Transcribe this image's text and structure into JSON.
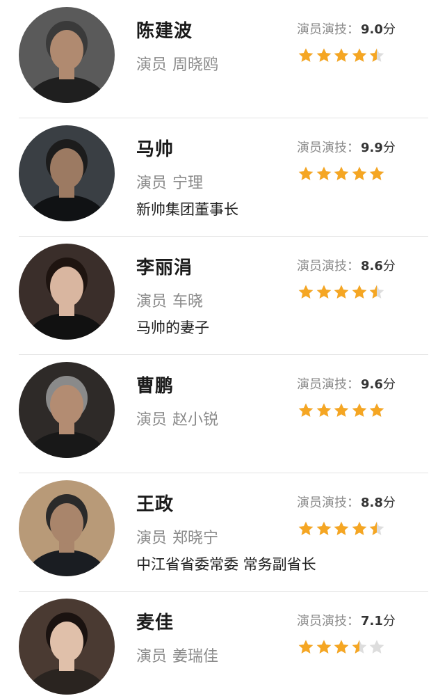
{
  "rating_label": "演员演技：",
  "rating_unit": "分",
  "role_label": "演员",
  "colors": {
    "star_filled": "#f5a623",
    "star_empty": "#dddddd",
    "divider": "#e3e3e3"
  },
  "cast": [
    {
      "character": "陈建波",
      "actor": "周晓鸥",
      "description": "",
      "score": "9.0",
      "stars": 4.5,
      "avatar": {
        "bg": "#5a5a5a",
        "skin": "#b08a70",
        "hair": "#3a3a3a",
        "clothes": "#1f1f1f"
      }
    },
    {
      "character": "马帅",
      "actor": "宁理",
      "description": "新帅集团董事长",
      "score": "9.9",
      "stars": 5,
      "avatar": {
        "bg": "#3a3f44",
        "skin": "#9c7a62",
        "hair": "#1c1c1c",
        "clothes": "#101214"
      }
    },
    {
      "character": "李丽涓",
      "actor": "车晓",
      "description": "马帅的妻子",
      "score": "8.6",
      "stars": 4.5,
      "avatar": {
        "bg": "#3a2e2a",
        "skin": "#d9b6a0",
        "hair": "#1e1410",
        "clothes": "#111111"
      }
    },
    {
      "character": "曹鹏",
      "actor": "赵小锐",
      "description": "",
      "score": "9.6",
      "stars": 5,
      "avatar": {
        "bg": "#2e2a28",
        "skin": "#b38c72",
        "hair": "#8a8a8a",
        "clothes": "#181818"
      }
    },
    {
      "character": "王政",
      "actor": "郑晓宁",
      "description": "中江省省委常委 常务副省长",
      "score": "8.8",
      "stars": 4.5,
      "avatar": {
        "bg": "#b89a78",
        "skin": "#a9856b",
        "hair": "#2a2a2a",
        "clothes": "#1a1d22"
      }
    },
    {
      "character": "麦佳",
      "actor": "姜瑞佳",
      "description": "",
      "score": "7.1",
      "stars": 3.5,
      "avatar": {
        "bg": "#4a3a32",
        "skin": "#e0c0aa",
        "hair": "#1a1210",
        "clothes": "#2a2420"
      }
    }
  ]
}
